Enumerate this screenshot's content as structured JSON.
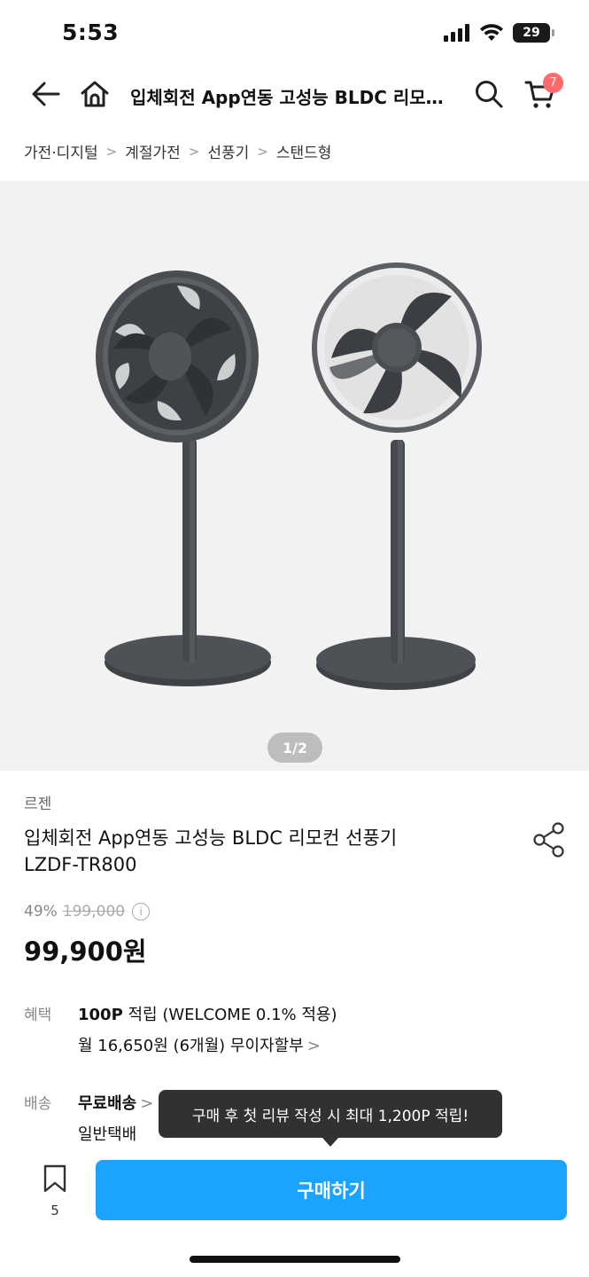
{
  "status_bar": {
    "time": "5:53",
    "battery": "29"
  },
  "header": {
    "title": "입체회전 App연동 고성능 BLDC 리모컨 선풍기 LZDF-TR800",
    "cart_count": "7"
  },
  "breadcrumb": [
    "가전·디지털",
    "계절가전",
    "선풍기",
    "스탠드형"
  ],
  "image": {
    "indicator": "1/2"
  },
  "product": {
    "brand": "르젠",
    "name_line1": "입체회전 App연동 고성능 BLDC 리모컨 선풍기",
    "name_line2": "LZDF-TR800",
    "discount": "49%",
    "original_price": "199,000",
    "price": "99,900원"
  },
  "benefit": {
    "label": "혜택",
    "points_bold": "100P",
    "points_rest": " 적립 (WELCOME 0.1% 적용)",
    "installment": "월 16,650원 (6개월) 무이자할부"
  },
  "delivery": {
    "label": "배송",
    "type": "무료배송",
    "method": "일반택배"
  },
  "tooltip": "구매 후 첫 리뷰 작성 시 최대 1,200P 적립!",
  "bottom": {
    "bookmark_count": "5",
    "buy_label": "구매하기"
  },
  "colors": {
    "accent": "#1aa3ff",
    "badge": "#ff6b6b",
    "tooltip_bg": "#2f3133"
  }
}
